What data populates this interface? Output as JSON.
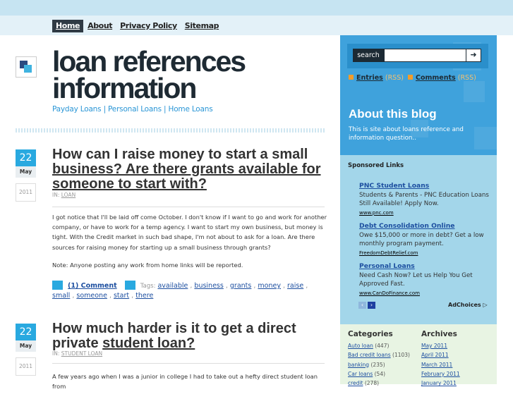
{
  "nav": {
    "items": [
      "Home",
      "About",
      "Privacy Policy",
      "Sitemap"
    ]
  },
  "site": {
    "title": "loan references information",
    "tagline": [
      "Payday Loans",
      "Personal Loans",
      "Home Loans"
    ],
    "tagline_sep": "|"
  },
  "posts": [
    {
      "day": "22",
      "month": "May",
      "year": "2011",
      "title_plain": "How can I raise money to start a small",
      "title_link": "business? Are there grants available for someone to start with?",
      "cat_prefix": "IN:",
      "category": "LOAN",
      "body": [
        "I got notice that I'll be laid off come October. I don't know if I want to go and work for another company, or have to work for a temp agency. I want to start my own business, but money is tight. With the Credit market in such bad shape, I'm not about to ask for a loan. Are there sources for raising money for starting up a small business through grants?",
        "Note: Anyone posting any work from home links will be reported."
      ],
      "comments": "(1) Comment",
      "tags_label": "Tags:",
      "tags": [
        "available",
        "business",
        "grants",
        "money",
        "raise",
        "small",
        "someone",
        "start",
        "there"
      ]
    },
    {
      "day": "22",
      "month": "May",
      "year": "2011",
      "title_plain": "How much harder is it to get a direct private",
      "title_link": "student loan?",
      "cat_prefix": "IN:",
      "category": "STUDENT LOAN",
      "body": [
        "A few years ago when I was a junior in college I had to take out a hefty direct student loan from"
      ]
    }
  ],
  "sidebar": {
    "search_label": "search",
    "search_value": "",
    "search_btn": "➜",
    "rss": {
      "entries": "Entries",
      "comments": "Comments",
      "rss_tag": "(RSS)"
    },
    "about_title": "About this blog",
    "about_text": "This is site about loans reference and information question..",
    "sponsored_title": "Sponsored Links",
    "ads": [
      {
        "title": "PNC Student Loans",
        "text": "Students & Parents - PNC Education Loans Still Available! Apply Now.",
        "url": "www.pnc.com"
      },
      {
        "title": "Debt Consolidation Online",
        "text": "Owe $15,000 or more in debt? Get a low monthly program payment.",
        "url": "FreedomDebtRelief.com"
      },
      {
        "title": "Personal Loans",
        "text": "Need Cash Now? Let us Help You Get Approved Fast.",
        "url": "www.CanDoFinance.com"
      }
    ],
    "ad_prev": "‹",
    "ad_next": "›",
    "adchoices": "AdChoices ▷",
    "categories_title": "Categories",
    "categories": [
      {
        "name": "Auto loan",
        "count": "(447)"
      },
      {
        "name": "Bad credit loans",
        "count": "(1103)"
      },
      {
        "name": "banking",
        "count": "(235)"
      },
      {
        "name": "Car loans",
        "count": "(54)"
      },
      {
        "name": "credit",
        "count": "(278)"
      }
    ],
    "archives_title": "Archives",
    "archives": [
      "May 2011",
      "April 2011",
      "March 2011",
      "February 2011",
      "January 2011"
    ]
  }
}
